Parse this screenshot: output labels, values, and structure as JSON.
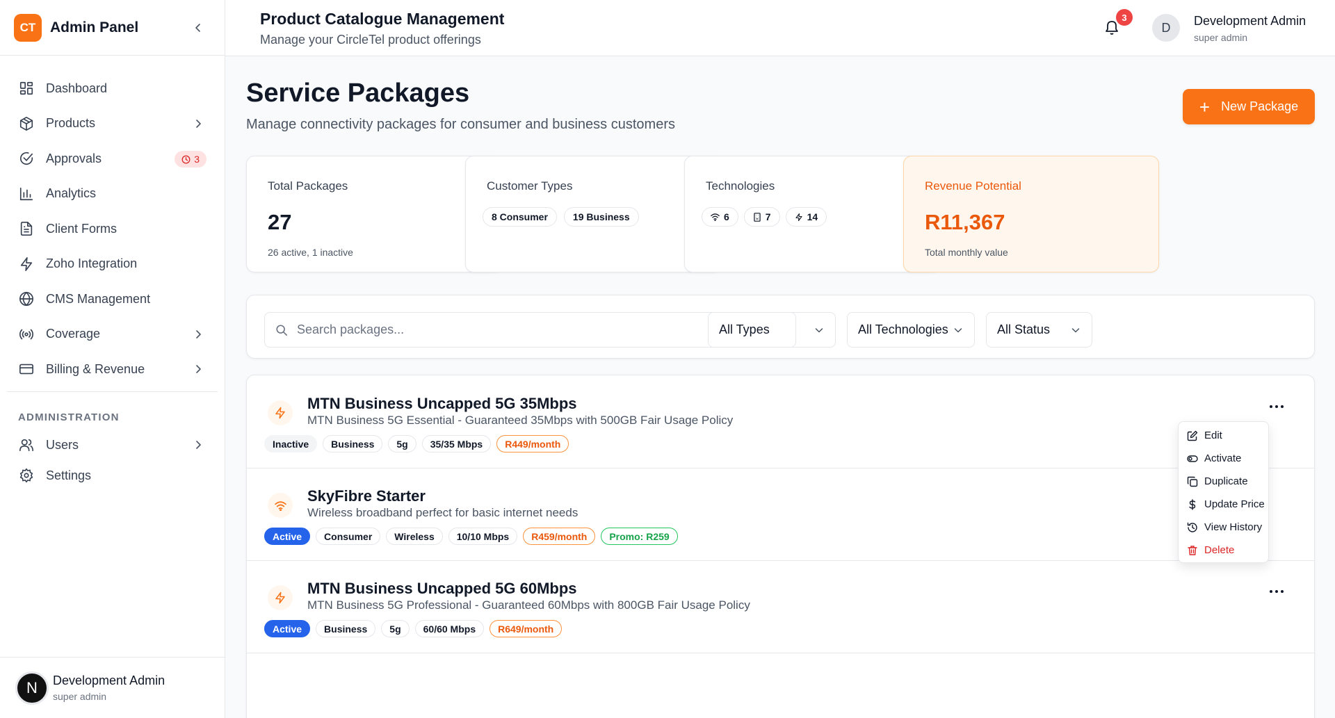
{
  "sidebar": {
    "logo": "CT",
    "title": "Admin Panel",
    "items": [
      {
        "label": "Dashboard"
      },
      {
        "label": "Products"
      },
      {
        "label": "Approvals",
        "badge": "3"
      },
      {
        "label": "Analytics"
      },
      {
        "label": "Client Forms"
      },
      {
        "label": "Zoho Integration"
      },
      {
        "label": "CMS Management"
      },
      {
        "label": "Coverage"
      },
      {
        "label": "Billing & Revenue"
      }
    ],
    "section_label": "ADMINISTRATION",
    "admin_items": [
      {
        "label": "Users"
      },
      {
        "label": "Settings"
      }
    ],
    "footer": {
      "avatar": "N",
      "name": "Development Admin",
      "role": "super admin"
    }
  },
  "topbar": {
    "title": "Product Catalogue Management",
    "subtitle": "Manage your CircleTel product offerings",
    "notification_count": "3",
    "avatar": "D",
    "user_name": "Development Admin",
    "user_role": "super admin"
  },
  "page": {
    "title": "Service Packages",
    "subtitle": "Manage connectivity packages for consumer and business customers",
    "new_button": "New Package"
  },
  "stats": {
    "total": {
      "label": "Total Packages",
      "value": "27",
      "note": "26 active, 1 inactive"
    },
    "customer_types": {
      "label": "Customer Types",
      "consumer": "8 Consumer",
      "business": "19 Business"
    },
    "technologies": {
      "label": "Technologies",
      "wireless": "6",
      "fibre": "7",
      "fiveg": "14"
    },
    "revenue": {
      "label": "Revenue Potential",
      "value": "R11,367",
      "note": "Total monthly value"
    }
  },
  "filters": {
    "search_placeholder": "Search packages...",
    "types": "All Types",
    "technologies": "All Technologies",
    "status": "All Status"
  },
  "packages": [
    {
      "name": "MTN Business Uncapped 5G 35Mbps",
      "description": "MTN Business 5G Essential - Guaranteed 35Mbps with 500GB Fair Usage Policy",
      "status": "Inactive",
      "type": "Business",
      "tech": "5g",
      "speed": "35/35 Mbps",
      "price": "R449/month"
    },
    {
      "name": "SkyFibre Starter",
      "description": "Wireless broadband perfect for basic internet needs",
      "status": "Active",
      "type": "Consumer",
      "tech": "Wireless",
      "speed": "10/10 Mbps",
      "price": "R459/month",
      "promo": "Promo: R259"
    },
    {
      "name": "MTN Business Uncapped 5G 60Mbps",
      "description": "MTN Business 5G Professional - Guaranteed 60Mbps with 800GB Fair Usage Policy",
      "status": "Active",
      "type": "Business",
      "tech": "5g",
      "speed": "60/60 Mbps",
      "price": "R649/month"
    }
  ],
  "context_menu": {
    "edit": "Edit",
    "activate": "Activate",
    "duplicate": "Duplicate",
    "update_price": "Update Price",
    "view_history": "View History",
    "delete": "Delete"
  },
  "colors": {
    "accent": "#f97316",
    "active": "#2563eb",
    "danger": "#dc2626",
    "promo": "#16a34a"
  }
}
